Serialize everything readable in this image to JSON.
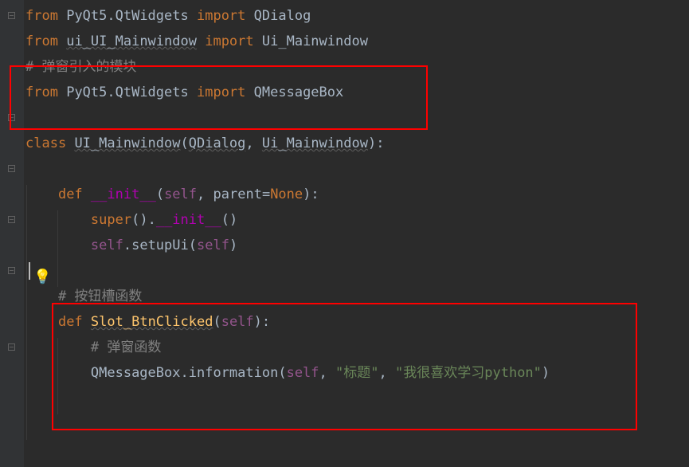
{
  "code": {
    "l1": {
      "kw_from": "from",
      "mod1": "PyQt5.QtWidgets",
      "kw_import": "import",
      "name1": "QDialog"
    },
    "l2": {
      "kw_from": "from",
      "mod2": "ui_UI_Mainwindow",
      "kw_import": "import",
      "name2": "Ui_Mainwindow"
    },
    "l3": {
      "cmt": "# 弹窗引入的模块"
    },
    "l4": {
      "kw_from": "from",
      "mod": "PyQt5.QtWidgets",
      "kw_import": "import",
      "name": "QMessageBox"
    },
    "l6": {
      "kw_class": "class",
      "clsname": "UI_Mainwindow",
      "lp": "(",
      "base1": "QDialog",
      "comma": ",",
      "sp": " ",
      "base2": "Ui_Mainwindow",
      "rp": ")",
      "colon": ":"
    },
    "l8": {
      "kw_def": "def",
      "fn": "__init__",
      "lp": "(",
      "self": "self",
      "comma": ",",
      "sp": " ",
      "param": "parent",
      "eq": "=",
      "none": "None",
      "rp": ")",
      "colon": ":"
    },
    "l9": {
      "super": "super",
      "lp1": "(",
      "rp1": ")",
      "dot": ".",
      "init": "__init__",
      "lp2": "(",
      "rp2": ")"
    },
    "l10": {
      "self": "self",
      "dot": ".",
      "method": "setupUi",
      "lp": "(",
      "arg": "self",
      "rp": ")"
    },
    "l12": {
      "cmt": "# 按钮槽函数"
    },
    "l13": {
      "kw_def": "def",
      "fn": "Slot_BtnClicked",
      "lp": "(",
      "self": "self",
      "rp": ")",
      "colon": ":"
    },
    "l14": {
      "cmt": "# 弹窗函数"
    },
    "l15": {
      "cls": "QMessageBox",
      "dot": ".",
      "method": "information",
      "lp": "(",
      "self": "self",
      "c1": ",",
      "sp1": " ",
      "s1": "\"标题\"",
      "c2": ",",
      "sp2": " ",
      "s2": "\"我很喜欢学习python\"",
      "rp": ")"
    }
  },
  "icons": {
    "bulb": "💡"
  }
}
